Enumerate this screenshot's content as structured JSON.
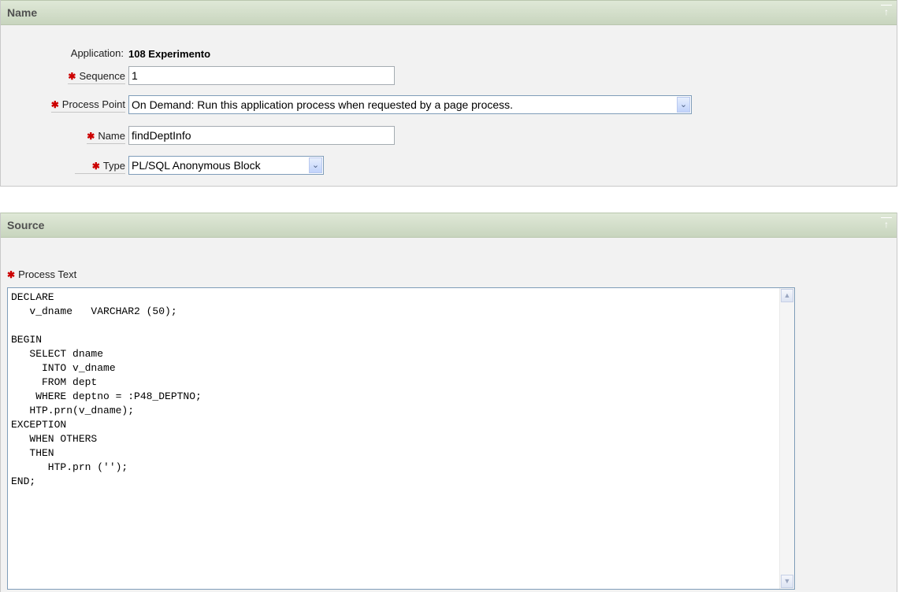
{
  "name_region": {
    "title": "Name",
    "application_label": "Application:",
    "application_value": "108 Experimento",
    "sequence_label": "Sequence",
    "sequence_value": "1",
    "process_point_label": "Process Point",
    "process_point_value": "On Demand: Run this application process when requested by a page process.",
    "name_label": "Name",
    "name_value": "findDeptInfo",
    "type_label": "Type",
    "type_value": "PL/SQL Anonymous Block"
  },
  "source_region": {
    "title": "Source",
    "process_text_label": "Process Text",
    "process_text_value": "DECLARE\n   v_dname   VARCHAR2 (50);\n\nBEGIN\n   SELECT dname\n     INTO v_dname\n     FROM dept\n    WHERE deptno = :P48_DEPTNO;\n   HTP.prn(v_dname);\nEXCEPTION\n   WHEN OTHERS\n   THEN\n      HTP.prn ('');\nEND;"
  },
  "icons": {
    "required": "✱",
    "top": "↑",
    "dropdown": "⌄"
  },
  "colors": {
    "header_bg": "#d3dec9",
    "region_bg": "#f2f2f2",
    "required": "#cc0000"
  }
}
